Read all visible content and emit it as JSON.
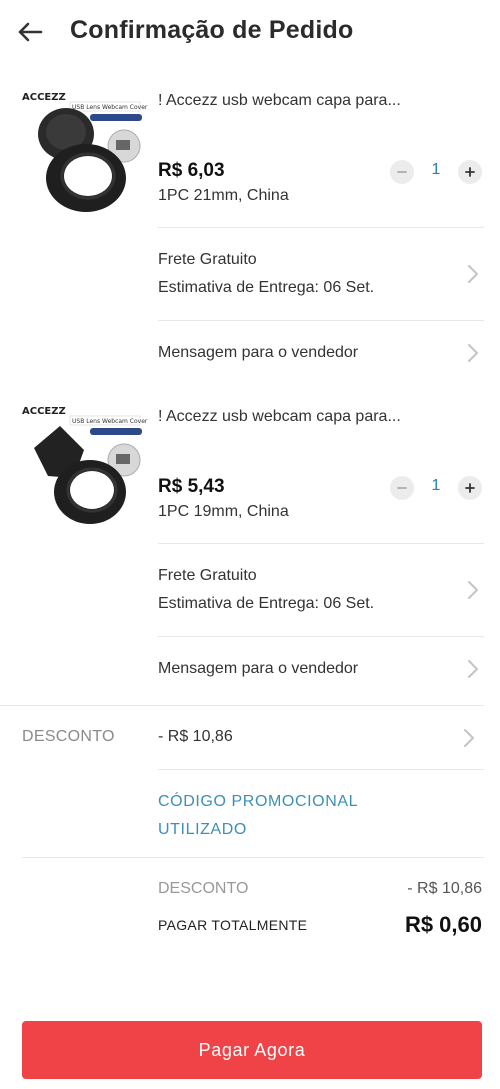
{
  "header": {
    "title": "Confirmação de Pedido"
  },
  "products": [
    {
      "title": "! Accezz usb webcam capa para...",
      "price": "R$ 6,03",
      "variant": "1PC 21mm,  China",
      "quantity": "1",
      "shipping": "Frete Gratuito",
      "delivery": "Estimativa de Entrega: 06 Set.",
      "message": "Mensagem para o vendedor"
    },
    {
      "title": "! Accezz usb webcam capa para...",
      "price": "R$ 5,43",
      "variant": "1PC 19mm,  China",
      "quantity": "1",
      "shipping": "Frete Gratuito",
      "delivery": "Estimativa de Entrega: 06 Set.",
      "message": "Mensagem para o vendedor"
    }
  ],
  "discount": {
    "label": "DESCONTO",
    "value": "- R$ 10,86"
  },
  "promo": {
    "label": "CÓDIGO PROMOCIONAL UTILIZADO"
  },
  "summary": {
    "discount_label": "DESCONTO",
    "discount_value": "- R$ 10,86",
    "total_label": "PAGAR TOTALMENTE",
    "total_value": "R$ 0,60"
  },
  "pay_button": {
    "label": "Pagar Agora"
  },
  "thumbnail": {
    "brand": "ACCEZZ",
    "caption": "USB Lens Webcam Cover"
  },
  "colors": {
    "accent": "#f04347",
    "link": "#3b8fb8",
    "stepper_value": "#2a7fb0"
  }
}
